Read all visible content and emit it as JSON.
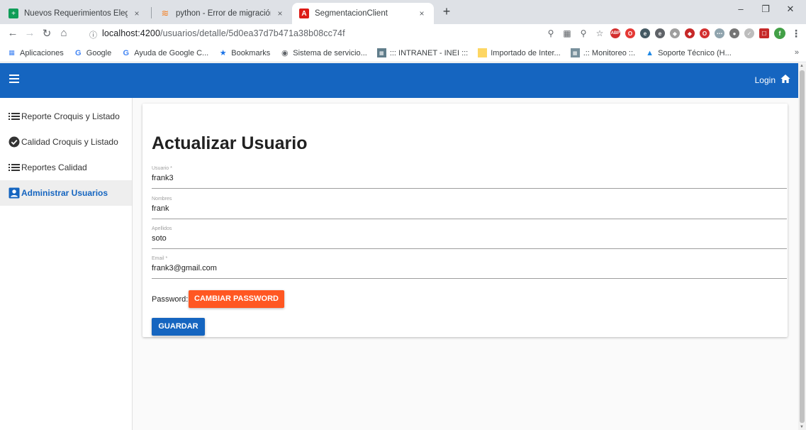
{
  "browser": {
    "tabs": [
      {
        "label": "Nuevos Requerimientos Elegajo",
        "icon": "google-sheets-icon",
        "active": false
      },
      {
        "label": "python - Error de migración de D",
        "icon": "stackoverflow-icon",
        "active": false
      },
      {
        "label": "SegmentacionClient",
        "icon": "angular-icon",
        "active": true
      }
    ],
    "close_glyph": "×",
    "new_tab_glyph": "+",
    "address": {
      "host": "localhost:4200",
      "path": "/usuarios/detalle/5d0ea37d7b471a38b08cc74f"
    },
    "bookmarks": [
      {
        "label": "Aplicaciones",
        "icon": "apps-grid-icon"
      },
      {
        "label": "Google",
        "icon": "google-icon"
      },
      {
        "label": "Ayuda de Google C...",
        "icon": "google-icon"
      },
      {
        "label": "Bookmarks",
        "icon": "star-icon"
      },
      {
        "label": "Sistema de servicio...",
        "icon": "globe-icon"
      },
      {
        "label": "::: INTRANET - INEI :::",
        "icon": "inei-icon"
      },
      {
        "label": "Importado de Inter...",
        "icon": "folder-icon"
      },
      {
        "label": ".:: Monitoreo ::.",
        "icon": "monitor-icon"
      },
      {
        "label": "Soporte Técnico (H...",
        "icon": "support-icon"
      }
    ],
    "bookmarks_more": "»",
    "extension_avatar": "f"
  },
  "app": {
    "header": {
      "login_label": "Login"
    },
    "sidebar": [
      {
        "label": "Reporte Croquis y Listado",
        "icon": "list-icon",
        "active": false
      },
      {
        "label": "Calidad Croquis y Listado",
        "icon": "check-circle-icon",
        "active": false
      },
      {
        "label": "Reportes Calidad",
        "icon": "list-icon",
        "active": false
      },
      {
        "label": "Administrar Usuarios",
        "icon": "account-box-icon",
        "active": true
      }
    ],
    "form": {
      "title": "Actualizar Usuario",
      "fields": [
        {
          "label": "Usuario *",
          "value": "frank3"
        },
        {
          "label": "Nombres",
          "value": "frank"
        },
        {
          "label": "Apellidos",
          "value": "soto"
        },
        {
          "label": "Email *",
          "value": "frank3@gmail.com"
        }
      ],
      "password_label": "Password:",
      "change_password_button": "CAMBIAR PASSWORD",
      "save_button": "GUARDAR"
    }
  },
  "colors": {
    "primary": "#1565c0",
    "accent": "#ff5722",
    "active_item_bg": "#eeeeee"
  }
}
